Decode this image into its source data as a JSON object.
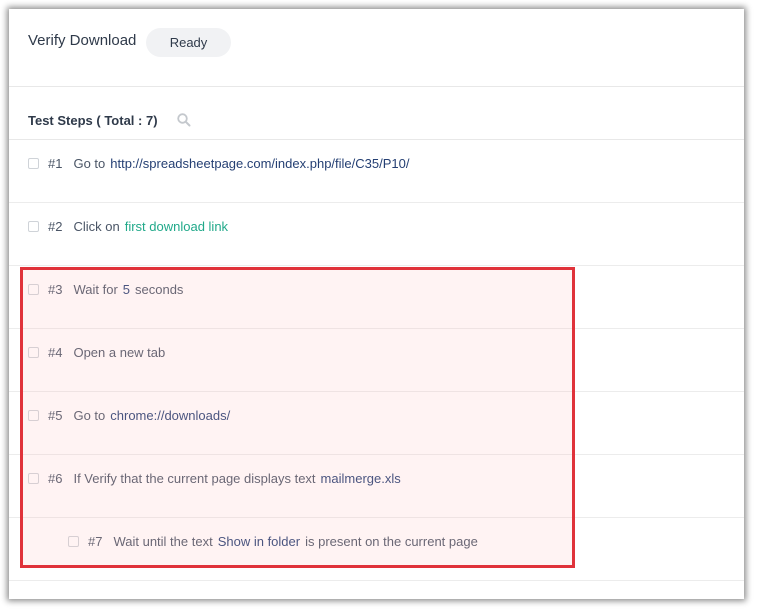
{
  "header": {
    "title": "Verify Download",
    "status": "Ready"
  },
  "steps_header": {
    "label": "Test Steps ( Total : 7)"
  },
  "steps": [
    {
      "num": "#1",
      "text": "Go to",
      "value": "http://spreadsheetpage.com/index.php/file/C35/P10/",
      "value_style": "value"
    },
    {
      "num": "#2",
      "text": "Click on",
      "value": "first download link",
      "value_style": "link"
    },
    {
      "num": "#3",
      "text": "Wait for",
      "value": "5",
      "suffix": "seconds",
      "value_style": "value"
    },
    {
      "num": "#4",
      "text": "Open a new tab"
    },
    {
      "num": "#5",
      "text": "Go to",
      "value": "chrome://downloads/",
      "value_style": "value"
    },
    {
      "num": "#6",
      "text": "If Verify that the current page displays text",
      "value": "mailmerge.xls",
      "value_style": "value"
    },
    {
      "num": "#7",
      "text": "Wait until the text",
      "value": "Show in folder",
      "suffix": "is present on the current page",
      "value_style": "value",
      "nested": true
    }
  ],
  "colors": {
    "highlight_border": "#e0323a",
    "value_text": "#243f73",
    "link_text": "#21a98a"
  }
}
